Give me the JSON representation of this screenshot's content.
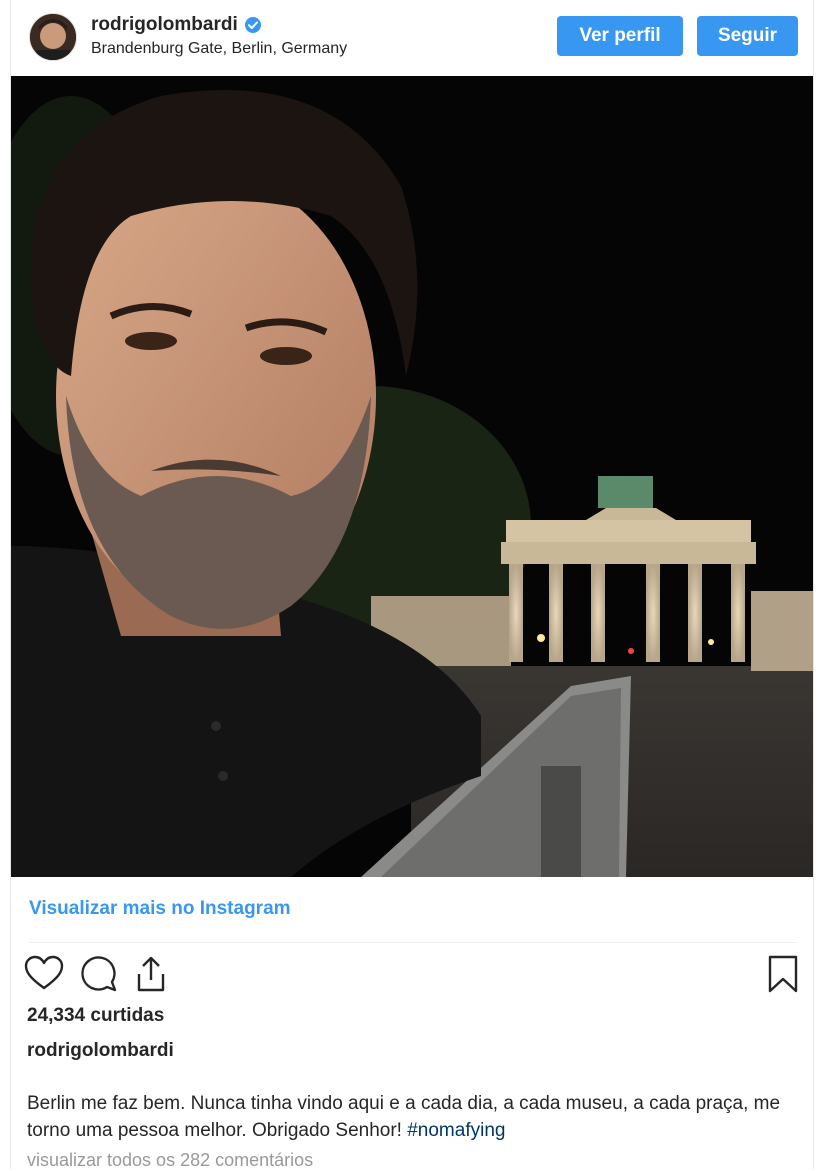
{
  "header": {
    "username": "rodrigolombardi",
    "location": "Brandenburg Gate, Berlin, Germany",
    "verified": true,
    "view_profile_label": "Ver perfil",
    "follow_label": "Seguir"
  },
  "post": {
    "view_more_label": "Visualizar mais no Instagram",
    "likes": "24,334 curtidas",
    "author": "rodrigolombardi",
    "caption_text": "Berlin me faz bem. Nunca tinha vindo aqui e a cada dia, a cada museu, a cada praça, me torno uma pessoa melhor. Obrigado Senhor! ",
    "hashtag": "#nomafying",
    "view_comments": "visualizar todos os 282 comentários"
  },
  "icons": {
    "like": "heart-icon",
    "comment": "comment-icon",
    "share": "share-icon",
    "save": "bookmark-icon",
    "verified": "verified-badge-icon"
  },
  "colors": {
    "accent": "#3897f0",
    "hashtag": "#003569",
    "muted": "#999999",
    "text": "#262626"
  }
}
